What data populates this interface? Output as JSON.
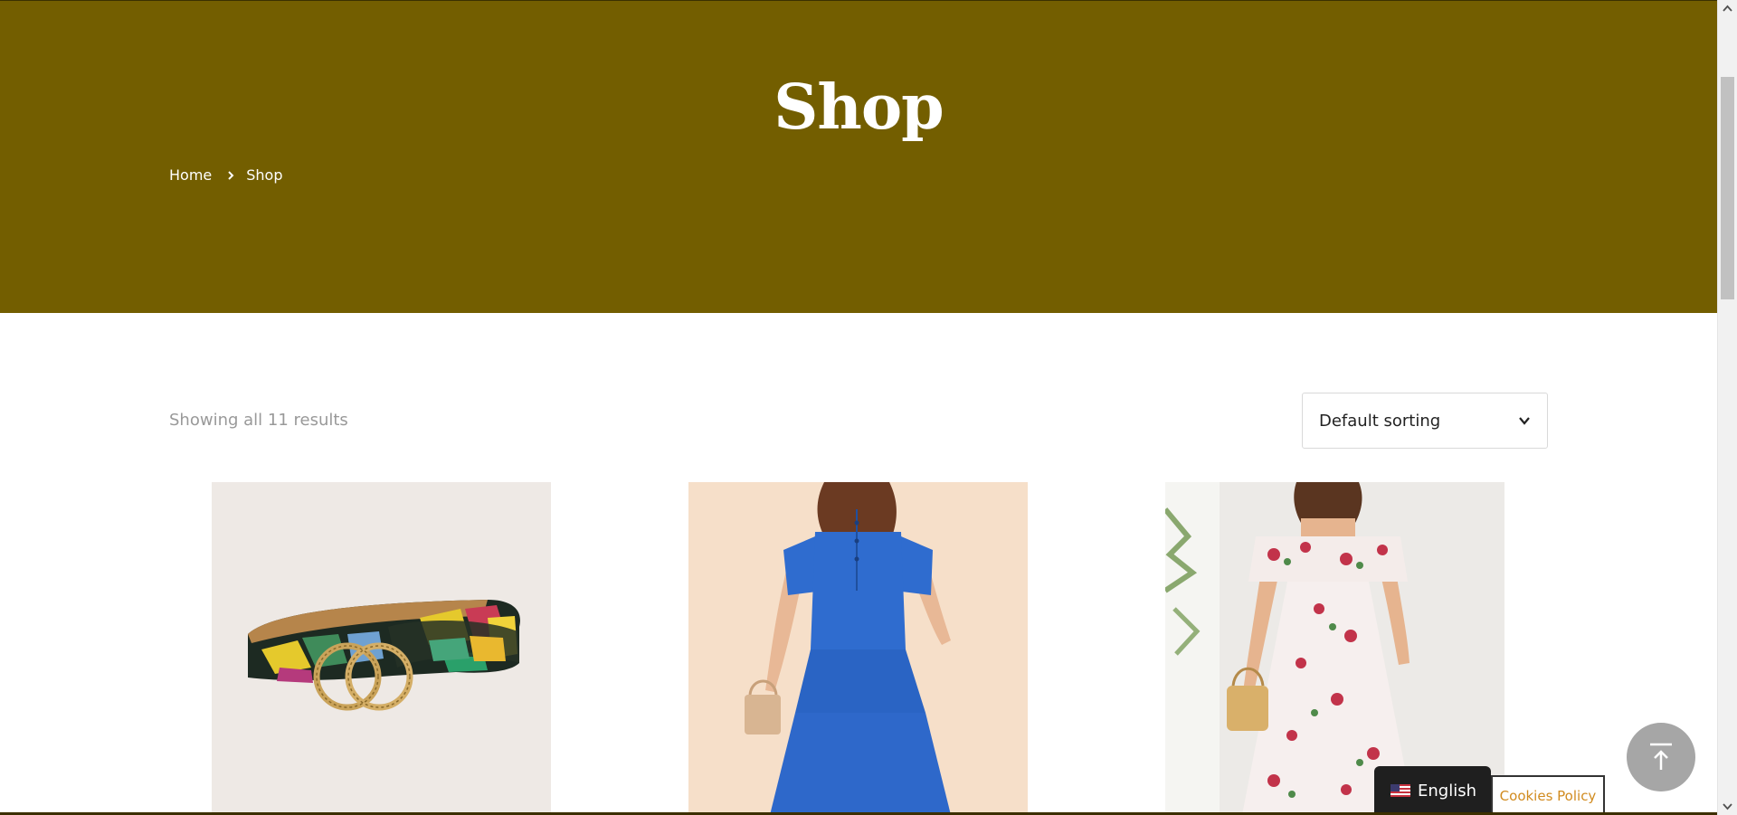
{
  "header": {
    "title": "Shop",
    "breadcrumb": {
      "home": "Home",
      "current": "Shop",
      "separator_icon": "chevron-right-icon"
    }
  },
  "shop": {
    "result_count": "Showing all 11 results",
    "sort": {
      "selected": "Default sorting",
      "icon": "chevron-down-icon"
    },
    "products": [
      {
        "image": "snakeskin-belt-image"
      },
      {
        "image": "blue-tiered-dress-image"
      },
      {
        "image": "floral-off-shoulder-dress-image"
      }
    ]
  },
  "widgets": {
    "back_to_top_icon": "arrow-to-top-icon",
    "language": "English",
    "language_flag": "us-flag-icon",
    "cookies": "Cookies Policy"
  },
  "colors": {
    "hero_background": "#735e00",
    "cookies_link": "#d18b1f",
    "back_to_top": "#a6a6a6"
  }
}
